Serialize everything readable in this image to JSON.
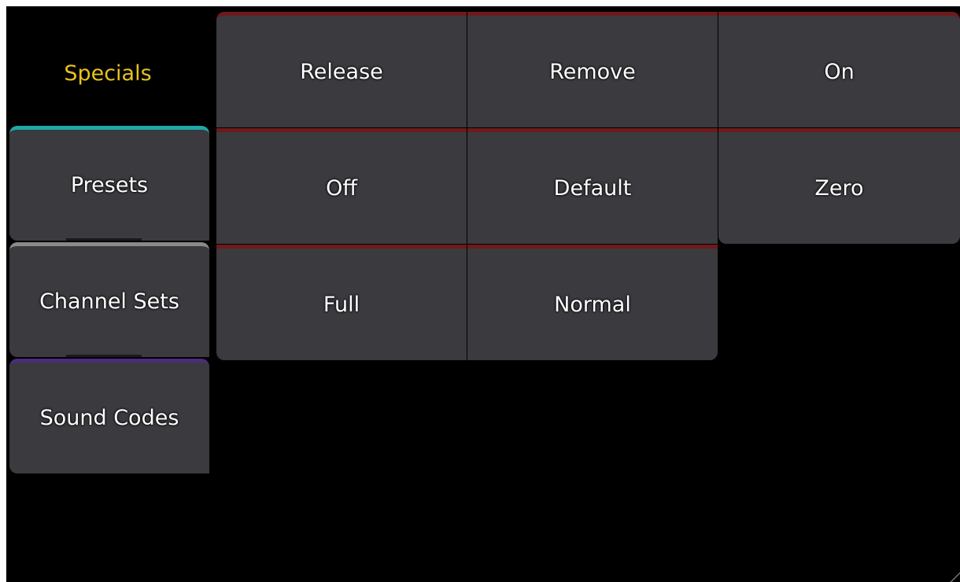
{
  "categories": {
    "active": {
      "label": "Specials",
      "color": "#e8c21a"
    },
    "tabs": [
      {
        "label": "Presets",
        "accent": "#1fa8a8"
      },
      {
        "label": "Channel Sets",
        "accent": "#8a8a8a"
      },
      {
        "label": "Sound Codes",
        "accent": "#4a2d7a"
      }
    ]
  },
  "buttons": [
    {
      "label": "Release"
    },
    {
      "label": "Remove"
    },
    {
      "label": "On"
    },
    {
      "label": "Off"
    },
    {
      "label": "Default"
    },
    {
      "label": "Zero"
    },
    {
      "label": "Full"
    },
    {
      "label": "Normal"
    }
  ],
  "colors": {
    "button_bg": "#3a3a3f",
    "button_top_border": "#6e1a1c",
    "background": "#000000"
  }
}
